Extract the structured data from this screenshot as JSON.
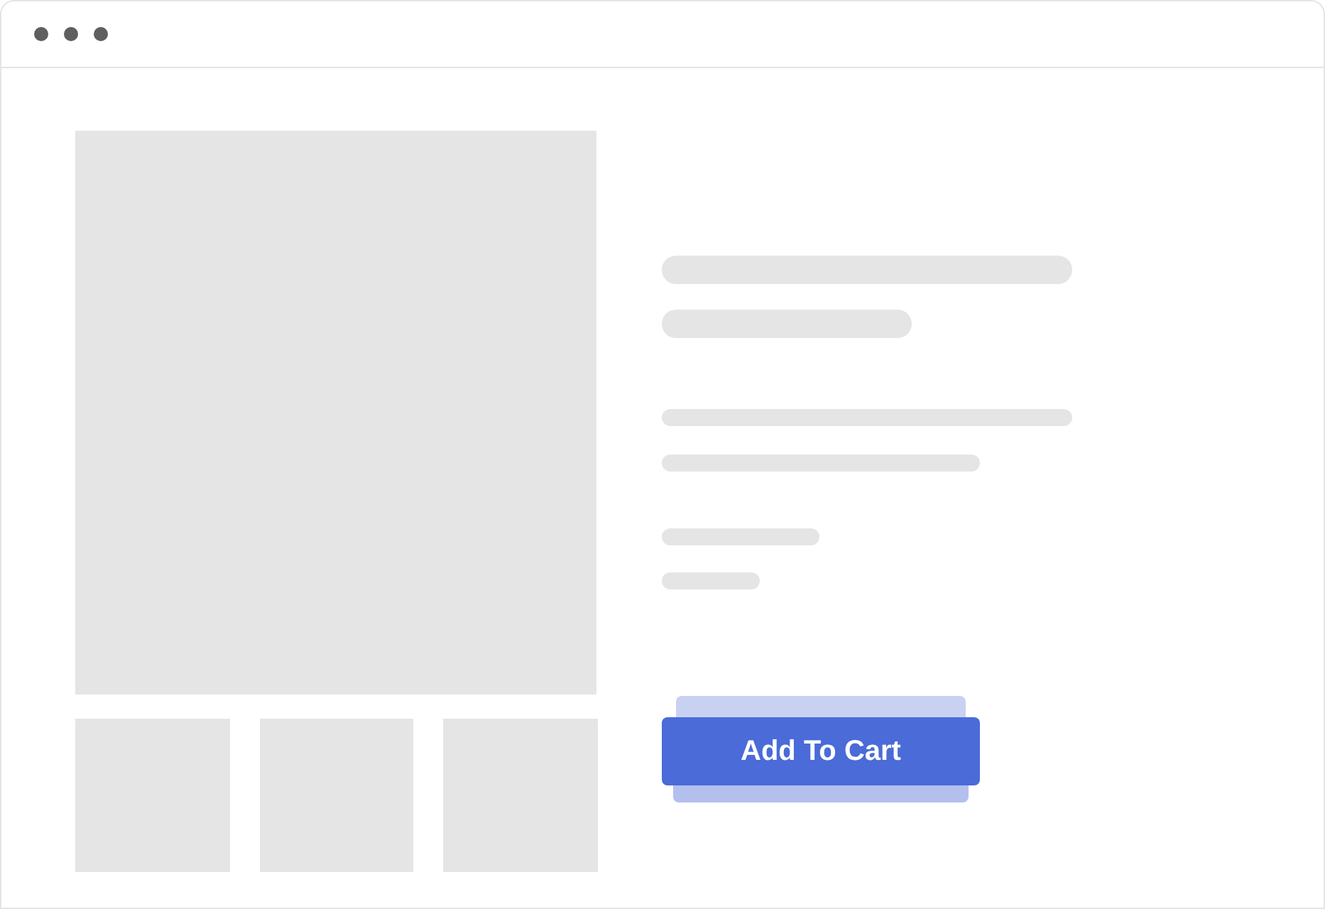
{
  "button": {
    "label": "Add To Cart"
  }
}
